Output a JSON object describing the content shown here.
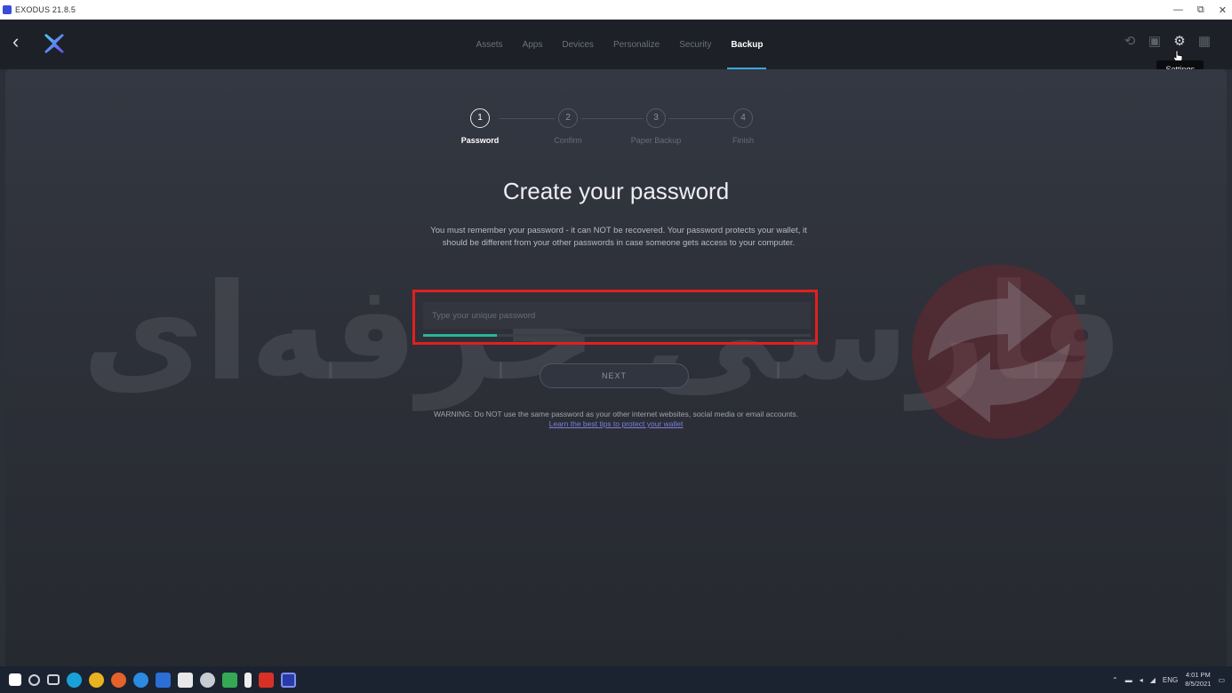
{
  "window": {
    "title": "EXODUS 21.8.5",
    "controls": [
      "—",
      "⧉",
      "✕"
    ]
  },
  "header": {
    "back_icon": "chevron-left-icon",
    "tabs": [
      {
        "label": "Assets",
        "active": false
      },
      {
        "label": "Apps",
        "active": false
      },
      {
        "label": "Devices",
        "active": false
      },
      {
        "label": "Personalize",
        "active": false
      },
      {
        "label": "Security",
        "active": false
      },
      {
        "label": "Backup",
        "active": true
      }
    ],
    "icons": [
      "history-icon",
      "lock-icon",
      "gear-icon",
      "grid-icon"
    ],
    "tooltip": "Settings"
  },
  "stepper": {
    "steps": [
      {
        "number": "1",
        "label": "Password",
        "active": true
      },
      {
        "number": "2",
        "label": "Confirm",
        "active": false
      },
      {
        "number": "3",
        "label": "Paper Backup",
        "active": false
      },
      {
        "number": "4",
        "label": "Finish",
        "active": false
      }
    ]
  },
  "main": {
    "heading": "Create your password",
    "description": "You must remember your password - it can NOT be recovered. Your password protects your wallet, it should be different from your other passwords in case someone gets access to your computer.",
    "password_placeholder": "Type your unique password",
    "password_strength": 0.19,
    "next_label": "NEXT",
    "warning": "WARNING: Do NOT use the same password as your other internet websites, social media or email accounts.",
    "learn_link": "Learn the best tips to protect your wallet"
  },
  "watermark": {
    "text": "فارسی حرفه‌ای"
  },
  "taskbar": {
    "clock_time": "4:01 PM",
    "clock_date": "8/5/2021",
    "lang": "ENG"
  },
  "colors": {
    "accent": "#3aa5d8",
    "strength": "#2bb39a",
    "highlight": "#e02020"
  }
}
